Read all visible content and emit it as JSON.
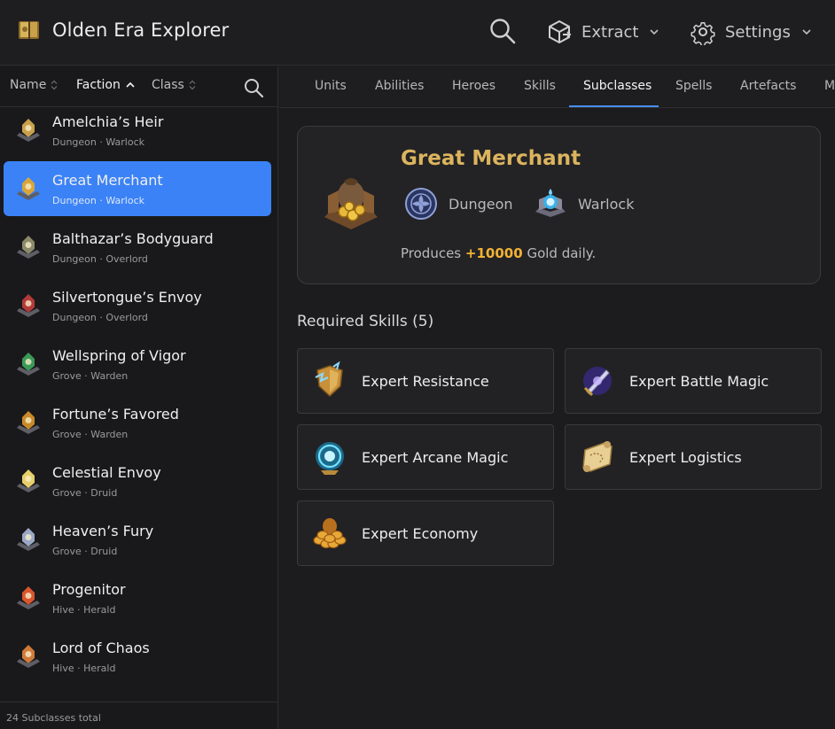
{
  "app": {
    "title": "Olden Era Explorer",
    "icon": "book-icon"
  },
  "header": {
    "search_icon": "search-icon",
    "extract_label": "Extract",
    "settings_label": "Settings"
  },
  "sidebar": {
    "sort": {
      "name": "Name",
      "faction": "Faction",
      "class": "Class",
      "active": "Faction"
    },
    "items": [
      {
        "name": "Amelchia’s Heir",
        "meta": "Dungeon · Warlock",
        "icon": "staff-emblem-icon",
        "color": "#c9a14a"
      },
      {
        "name": "Great Merchant",
        "meta": "Dungeon · Warlock",
        "icon": "gold-sack-icon",
        "color": "#d9a53a"
      },
      {
        "name": "Balthazar’s Bodyguard",
        "meta": "Dungeon · Overlord",
        "icon": "horned-helm-icon",
        "color": "#8a8a6a"
      },
      {
        "name": "Silvertongue’s Envoy",
        "meta": "Dungeon · Overlord",
        "icon": "red-mask-icon",
        "color": "#b43a3a"
      },
      {
        "name": "Wellspring of Vigor",
        "meta": "Grove · Warden",
        "icon": "green-orb-icon",
        "color": "#3c9a58"
      },
      {
        "name": "Fortune’s Favored",
        "meta": "Grove · Warden",
        "icon": "golden-lamp-icon",
        "color": "#c98a2a"
      },
      {
        "name": "Celestial Envoy",
        "meta": "Grove · Druid",
        "icon": "star-burst-icon",
        "color": "#e6cf6a"
      },
      {
        "name": "Heaven’s Fury",
        "meta": "Grove · Druid",
        "icon": "storm-cloud-icon",
        "color": "#9aa8c4"
      },
      {
        "name": "Progenitor",
        "meta": "Hive · Herald",
        "icon": "flame-wing-icon",
        "color": "#d8562e"
      },
      {
        "name": "Lord of Chaos",
        "meta": "Hive · Herald",
        "icon": "chaos-claw-icon",
        "color": "#d07a3a"
      }
    ],
    "footer": "24 Subclasses total"
  },
  "tabs": [
    "Units",
    "Abilities",
    "Heroes",
    "Skills",
    "Subclasses",
    "Spells",
    "Artefacts",
    "M"
  ],
  "active_tab": "Subclasses",
  "detail": {
    "title": "Great Merchant",
    "faction": "Dungeon",
    "class": "Warlock",
    "desc_prefix": "Produces",
    "desc_value": "+10000",
    "desc_suffix": "Gold daily.",
    "accent_color": "#dcb45e",
    "value_color": "#f2b233"
  },
  "skills": {
    "heading": "Required Skills (5)",
    "items": [
      {
        "label": "Expert Resistance",
        "icon": "shield-lightning-icon"
      },
      {
        "label": "Expert Battle Magic",
        "icon": "magic-sword-icon"
      },
      {
        "label": "Expert Arcane Magic",
        "icon": "arcane-orb-icon"
      },
      {
        "label": "Expert Logistics",
        "icon": "scroll-map-icon"
      },
      {
        "label": "Expert Economy",
        "icon": "gold-coins-icon"
      }
    ]
  },
  "colors": {
    "selection": "#3b82f6",
    "tab_underline": "#4a8ff5",
    "background": "#1c1c1e"
  }
}
